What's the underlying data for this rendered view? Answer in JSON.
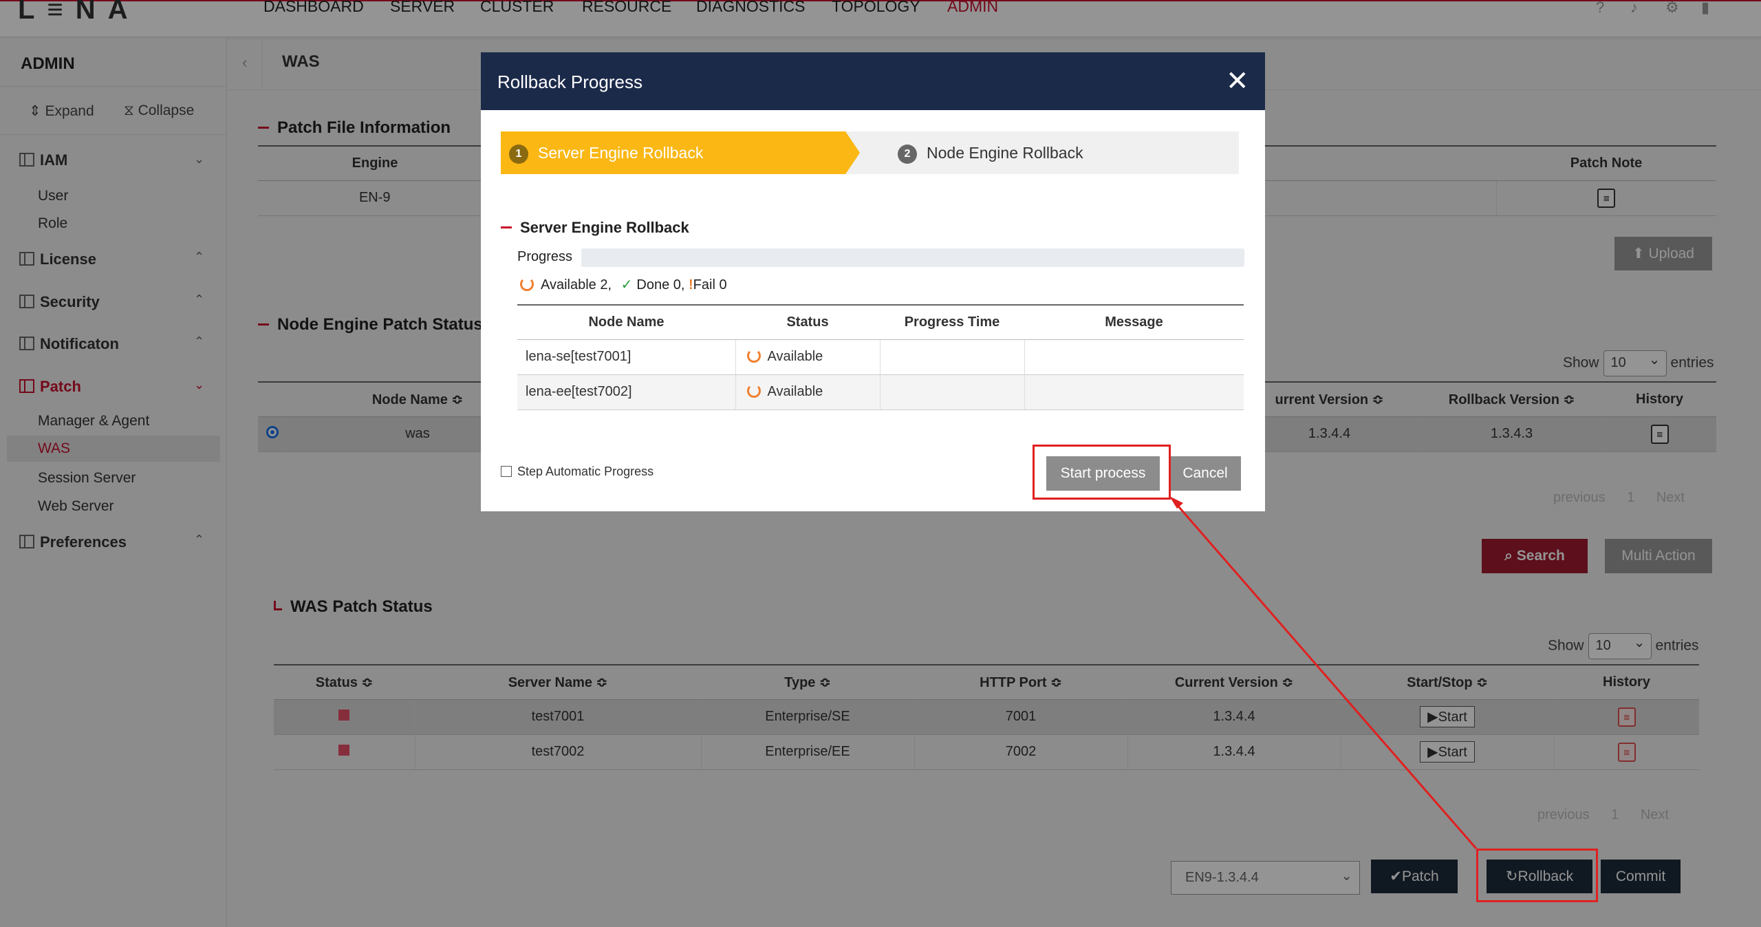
{
  "app": {
    "logo": "L≡NA"
  },
  "nav": [
    "DASHBOARD",
    "SERVER",
    "CLUSTER",
    "RESOURCE",
    "DIAGNOSTICS",
    "TOPOLOGY",
    "ADMIN"
  ],
  "top_icons": [
    "help-icon",
    "bell-icon",
    "gear-icon",
    "logout-icon"
  ],
  "sidebar": {
    "title": "ADMIN",
    "expand": "Expand",
    "collapse": "Collapse",
    "groups": {
      "iam": "IAM",
      "user": "User",
      "role": "Role",
      "license": "License",
      "security": "Security",
      "notification": "Notificaton",
      "patch": "Patch",
      "manager_agent": "Manager & Agent",
      "was": "WAS",
      "session_server": "Session Server",
      "web_server": "Web Server",
      "preferences": "Preferences"
    }
  },
  "breadcrumb": "WAS",
  "patch_file": {
    "title": "Patch File Information",
    "headers": {
      "engine": "Engine",
      "patch_note": "Patch Note"
    },
    "row": {
      "engine": "EN-9"
    },
    "upload": "Upload"
  },
  "node_engine": {
    "title": "Node Engine Patch Status",
    "show": "Show",
    "entries": "entries",
    "page_size": "10",
    "headers": {
      "node_name": "Node Name ≎",
      "current_version": "urrent Version ≎",
      "rollback_version": "Rollback Version ≎",
      "history": "History"
    },
    "row": {
      "node_name": "was",
      "current_version": "1.3.4.4",
      "rollback_version": "1.3.4.3"
    },
    "pager": {
      "previous": "previous",
      "page": "1",
      "next": "Next"
    },
    "search": "Search",
    "multi_action": "Multi Action"
  },
  "was_patch": {
    "title": "WAS Patch Status",
    "show": "Show",
    "entries": "entries",
    "page_size": "10",
    "headers": [
      "Status ≎",
      "Server Name ≎",
      "Type ≎",
      "HTTP Port ≎",
      "Current Version ≎",
      "Start/Stop ≎",
      "History"
    ],
    "rows": [
      {
        "server": "test7001",
        "type": "Enterprise/SE",
        "port": "7001",
        "version": "1.3.4.4",
        "action": "Start"
      },
      {
        "server": "test7002",
        "type": "Enterprise/EE",
        "port": "7002",
        "version": "1.3.4.4",
        "action": "Start"
      }
    ],
    "pager": {
      "previous": "previous",
      "page": "1",
      "next": "Next"
    },
    "version_select": "EN9-1.3.4.4",
    "patch": "Patch",
    "rollback": "Rollback",
    "commit": "Commit"
  },
  "modal": {
    "title": "Rollback Progress",
    "step1_num": "1",
    "step1": "Server Engine Rollback",
    "step2_num": "2",
    "step2": "Node Engine Rollback",
    "section": "Server Engine Rollback",
    "progress_label": "Progress",
    "summary": {
      "available": "Available 2,",
      "done": "Done 0,",
      "fail": "Fail 0"
    },
    "headers": [
      "Node Name",
      "Status",
      "Progress Time",
      "Message"
    ],
    "rows": [
      {
        "node": "lena-se[test7001]",
        "status": "Available"
      },
      {
        "node": "lena-ee[test7002]",
        "status": "Available"
      }
    ],
    "step_auto": "Step Automatic Progress",
    "start": "Start process",
    "cancel": "Cancel"
  },
  "colors": {
    "accent": "#c8102e",
    "modal_header": "#1c2a4a",
    "step_active": "#fbb714",
    "annotation": "#e02020"
  }
}
